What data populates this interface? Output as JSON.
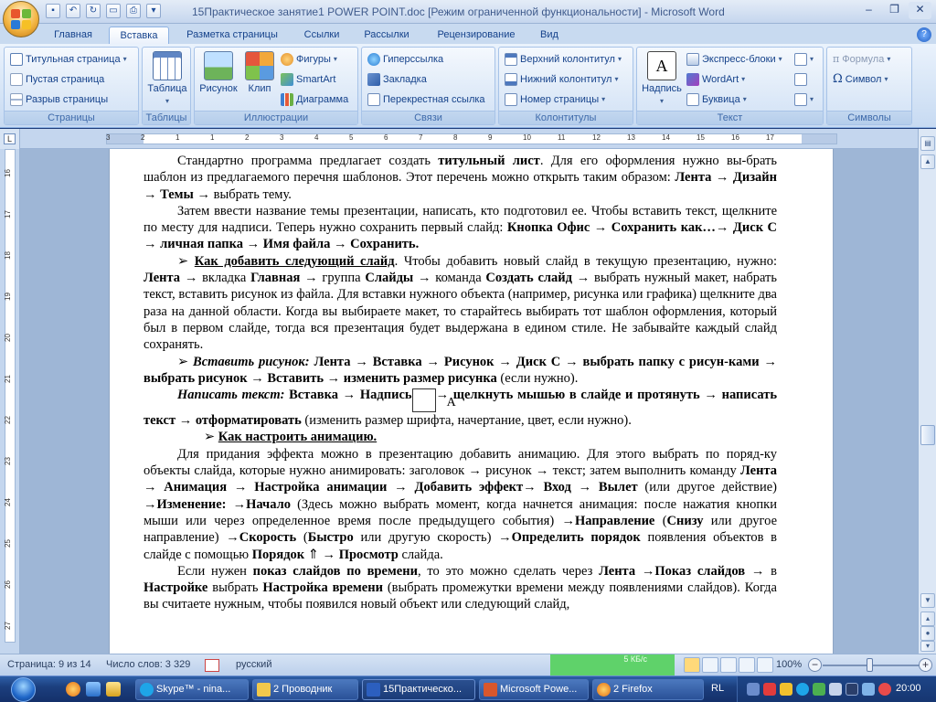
{
  "window": {
    "title": "15Практическое занятие1 POWER POINT.doc [Режим ограниченной функциональности] - Microsoft Word",
    "minimize": "–",
    "restore": "❐",
    "close": "✕"
  },
  "tabs": [
    "Главная",
    "Вставка",
    "Разметка страницы",
    "Ссылки",
    "Рассылки",
    "Рецензирование",
    "Вид"
  ],
  "active_tab": "Вставка",
  "ribbon": {
    "pages": {
      "label": "Страницы",
      "items": [
        "Титульная страница",
        "Пустая страница",
        "Разрыв страницы"
      ]
    },
    "tables": {
      "label": "Таблицы",
      "items": [
        "Таблица"
      ]
    },
    "illustrations": {
      "label": "Иллюстрации",
      "big": [
        "Рисунок",
        "Клип"
      ],
      "small": [
        "Фигуры",
        "SmartArt",
        "Диаграмма"
      ]
    },
    "links": {
      "label": "Связи",
      "items": [
        "Гиперссылка",
        "Закладка",
        "Перекрестная ссылка"
      ]
    },
    "headers": {
      "label": "Колонтитулы",
      "items": [
        "Верхний колонтитул",
        "Нижний колонтитул",
        "Номер страницы"
      ]
    },
    "text": {
      "label": "Текст",
      "big": "Надпись",
      "items": [
        "Экспресс-блоки",
        "WordArt",
        "Буквица"
      ]
    },
    "symbols": {
      "label": "Символы",
      "items": [
        "Формула",
        "Символ"
      ]
    }
  },
  "ruler": {
    "h_numbers": [
      "3",
      "2",
      "1",
      "1",
      "2",
      "3",
      "4",
      "5",
      "6",
      "7",
      "8",
      "9",
      "10",
      "11",
      "12",
      "13",
      "14",
      "15",
      "16",
      "17"
    ],
    "v_numbers": [
      "16",
      "17",
      "18",
      "19",
      "20",
      "21",
      "22",
      "23",
      "24",
      "25",
      "26",
      "27"
    ]
  },
  "document": {
    "p1": [
      "Стандартно программа предлагает создать ",
      "титульный лист",
      ". Для его оформления нужно вы-брать шаблон из предлагаемого перечня шаблонов. Этот перечень можно открыть таким образом: ",
      "Лента → Дизайн → Темы",
      " → выбрать тему."
    ],
    "p2": [
      "Затем ввести название темы презентации, написать, кто подготовил ее. Чтобы вставить текст, щелкните по месту для надписи. Теперь нужно сохранить первый слайд: ",
      "Кнопка Офис → Сохранить как…→ Диск С → личная папка → Имя файла → Сохранить."
    ],
    "p3": [
      "➢ ",
      "Как добавить следующий слайд",
      ". Чтобы добавить новый слайд в текущую презентацию, нужно: ",
      "Лента",
      " → вкладка ",
      "Главная",
      " → группа ",
      "Слайды",
      " → команда ",
      "Создать слайд",
      " → выбрать нужный макет, набрать текст, вставить рисунок из файла. Для вставки нужного объекта (например, рисунка или графика) щелкните два раза на данной области. Когда вы выбираете макет, то старайтесь выбирать тот шаблон оформления, который был в первом слайде, тогда вся презентация будет выдержана в едином стиле. Не забывайте каждый слайд сохранять."
    ],
    "p4": [
      "➢ ",
      "Вставить рисунок:",
      " Лента → Вставка → Рисунок → Диск С → выбрать папку с рисун-ками → выбрать рисунок → Вставить → изменить размер рисунка",
      " (если нужно)."
    ],
    "p5": [
      "Написать текст:",
      " Вставка → Надпись",
      "A",
      "→ щелкнуть мышью в слайде и протянуть → написать текст → отформатировать",
      " (изменить размер шрифта, начертание, цвет, если нужно)."
    ],
    "p6": [
      "➢ ",
      "Как настроить анимацию."
    ],
    "p7": [
      "Для придания эффекта можно в презентацию добавить анимацию. Для этого выбрать по поряд-ку объекты слайда, которые нужно анимировать: заголовок → рисунок → текст; затем выполнить команду ",
      "Лента → Анимация → Настройка анимации → Добавить эффект→ Вход → Вылет",
      " (или другое действие) ",
      "→Изменение: →Начало",
      " (Здесь можно выбрать момент, когда начнется анимация: после нажатия кнопки мыши или через определенное время после предыдущего события) ",
      "→Направление",
      " (",
      "Снизу",
      " или другое направление) ",
      "→Скорость",
      " (",
      "Быстро",
      " или другую скорость) ",
      "→Определить порядок",
      " появления объектов в слайде с помощью ",
      "Порядок",
      " ⇑ → ",
      "Просмотр",
      " слайда."
    ],
    "p8": [
      "Если нужен ",
      "показ слайдов по времени",
      ", то это можно сделать через ",
      "Лента",
      " →",
      "Показ слайдов",
      " → в ",
      "Настройке",
      " выбрать ",
      "Настройка времени",
      " (выбрать промежутки времени между появлениями слайдов). Когда вы считаете нужным, чтобы появился новый объект или следующий слайд,"
    ]
  },
  "statusbar": {
    "page": "Страница: 9 из 14",
    "words": "Число слов: 3 329",
    "language": "русский",
    "kb": "5 КБ/с",
    "zoom": "100%"
  },
  "taskbar": {
    "tasks": [
      "Skype™ - nina...",
      "2 Проводник",
      "15Практическо...",
      "Microsoft Powe...",
      "2 Firefox"
    ],
    "language": "RL",
    "clock": "20:00"
  },
  "colors": {
    "ribbon": "#d5e4f6",
    "accent": "#15428b",
    "taskbar": "#1c3f7e",
    "kb_widget": "#5fd26a"
  }
}
